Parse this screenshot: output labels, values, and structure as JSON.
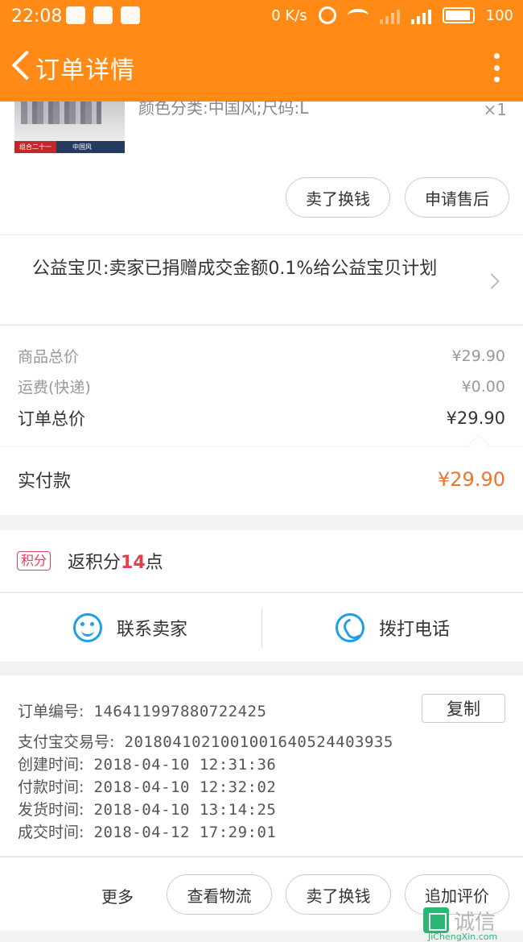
{
  "status_bar": {
    "time": "22:08",
    "speed": "0 K/s",
    "battery": "100"
  },
  "app_bar": {
    "title": "订单详情"
  },
  "item": {
    "spec": "颜色分类:中国风;尺码:L",
    "qty": "×1",
    "thumb_label_left": "组合二十一",
    "thumb_label_right": "中国风"
  },
  "item_actions": {
    "sell_label": "卖了换钱",
    "aftersale_label": "申请售后"
  },
  "charity": {
    "text": "公益宝贝:卖家已捐赠成交金额0.1%给公益宝贝计划"
  },
  "price": {
    "goods_label": "商品总价",
    "goods_value": "¥29.90",
    "shipping_label": "运费(快递)",
    "shipping_value": "¥0.00",
    "order_total_label": "订单总价",
    "order_total_value": "¥29.90",
    "paid_label": "实付款",
    "paid_value": "¥29.90"
  },
  "points": {
    "badge": "积分",
    "prefix": "返积分",
    "num": "14",
    "suffix": "点"
  },
  "contact": {
    "seller_label": "联系卖家",
    "call_label": "拨打电话"
  },
  "order_info": {
    "copy_label": "复制",
    "lines": [
      {
        "k": "订单编号:",
        "v": "1464119978807224​25"
      },
      {
        "k": "支付宝交易号:",
        "v": "2018041021001001640524403935"
      },
      {
        "k": "创建时间:",
        "v": "2018-04-10 12:31:36"
      },
      {
        "k": "付款时间:",
        "v": "2018-04-10 12:32:02"
      },
      {
        "k": "发货时间:",
        "v": "2018-04-10 13:14:25"
      },
      {
        "k": "成交时间:",
        "v": "2018-04-12 17:29:01"
      }
    ]
  },
  "bottom_bar": {
    "more_label": "更多",
    "logistics_label": "查看物流",
    "sell_label": "卖了换钱",
    "review_label": "追加评价"
  },
  "watermark": {
    "cn": "诚信",
    "en": "JiChengXin.com"
  },
  "colors": {
    "accent": "#ff8b16",
    "price_orange": "#f0742a",
    "icon_blue": "#1ea0e6",
    "points_red": "#d9435c"
  }
}
